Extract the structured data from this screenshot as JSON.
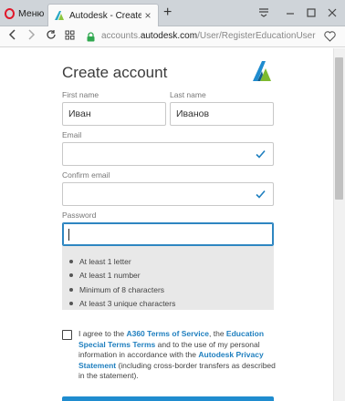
{
  "browser": {
    "menu_label": "Меню",
    "tab_title": "Autodesk - Create Account",
    "tab_close": "×",
    "new_tab": "+",
    "url_prefix": "accounts.",
    "url_domain": "autodesk.com",
    "url_path": "/User/RegisterEducationUser"
  },
  "page": {
    "title": "Create account",
    "first_name_label": "First name",
    "first_name_value": "Иван",
    "last_name_label": "Last name",
    "last_name_value": "Иванов",
    "email_label": "Email",
    "email_value": "",
    "confirm_email_label": "Confirm email",
    "confirm_email_value": "",
    "password_label": "Password",
    "password_value": "",
    "requirements": [
      "At least 1 letter",
      "At least 1 number",
      "Minimum of 8 characters",
      "At least 3 unique characters"
    ],
    "agree": {
      "t1": "I agree to the ",
      "link1": "A360 Terms of Service",
      "t2": ", the ",
      "link2": "Education Special Terms Terms",
      "t3": " and to the use of my personal information in accordance with the ",
      "link3": "Autodesk Privacy Statement",
      "t4": " (including cross-border transfers as described in the statement)."
    }
  },
  "colors": {
    "accent": "#1f7fbf",
    "check": "#1f7fbf",
    "focus": "#2e86c1",
    "opera": "#e0192b"
  },
  "icons": [
    "opera-icon",
    "autodesk-favicon",
    "back-icon",
    "forward-icon",
    "reload-icon",
    "tabs-grid-icon",
    "lock-icon",
    "heart-icon",
    "checkmark-icon",
    "autodesk-logo"
  ]
}
